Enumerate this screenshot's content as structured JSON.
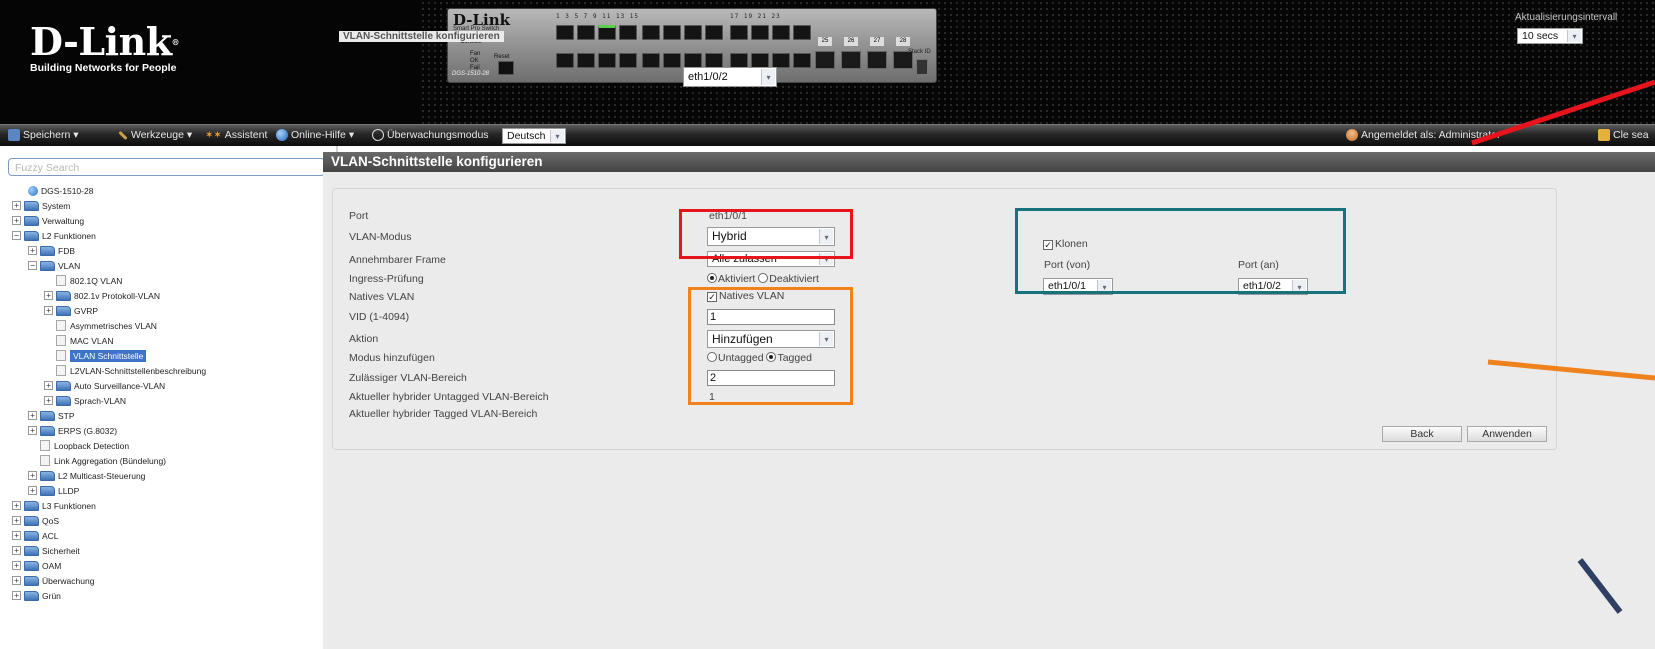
{
  "header": {
    "logo": {
      "name": "D-Link",
      "tagline": "Building Networks for People"
    },
    "switch_panel": {
      "brand": "D-Link",
      "subtitle": "Smart Pro Switch",
      "console_label": "Console",
      "fan_label": "Fan",
      "ok_label": "OK",
      "fail_label": "Fail",
      "reset_label": "Reset",
      "model": "DGS-1510-28",
      "stack_id_label": "Stack ID",
      "sfp_ports": [
        "25",
        "26",
        "27",
        "28"
      ],
      "port_selector": "eth1/0/2"
    },
    "refresh": {
      "label": "Aktualisierungsintervall",
      "value": "10 secs"
    }
  },
  "toolbar": {
    "save": "Speichern",
    "tools": "Werkzeuge",
    "wizard": "Assistent",
    "help": "Online-Hilfe",
    "monitor": "Überwachungsmodus",
    "language": "Deutsch",
    "logged_in": "Angemeldet als: Administrator",
    "clear_session": "Cle sea"
  },
  "sidebar": {
    "search_placeholder": "Fuzzy Search",
    "tree": [
      {
        "label": "DGS-1510-28"
      },
      {
        "label": "System"
      },
      {
        "label": "Verwaltung"
      },
      {
        "label": "L2 Funktionen"
      },
      {
        "label": "FDB"
      },
      {
        "label": "VLAN"
      },
      {
        "label": "802.1Q VLAN"
      },
      {
        "label": "802.1v Protokoll-VLAN"
      },
      {
        "label": "GVRP"
      },
      {
        "label": "Asymmetrisches VLAN"
      },
      {
        "label": "MAC VLAN"
      },
      {
        "label": "VLAN Schnittstelle"
      },
      {
        "label": "L2VLAN-Schnittstellenbeschreibung"
      },
      {
        "label": "Auto Surveillance-VLAN"
      },
      {
        "label": "Sprach-VLAN"
      },
      {
        "label": "STP"
      },
      {
        "label": "ERPS (G.8032)"
      },
      {
        "label": "Loopback Detection"
      },
      {
        "label": "Link Aggregation (Bündelung)"
      },
      {
        "label": "L2 Multicast-Steuerung"
      },
      {
        "label": "LLDP"
      },
      {
        "label": "L3 Funktionen"
      },
      {
        "label": "QoS"
      },
      {
        "label": "ACL"
      },
      {
        "label": "Sicherheit"
      },
      {
        "label": "OAM"
      },
      {
        "label": "Überwachung"
      },
      {
        "label": "Grün"
      }
    ]
  },
  "main": {
    "title": "VLAN-Schnittstelle konfigurieren",
    "legend": "VLAN-Schnittstelle konfigurieren",
    "labels": {
      "port": "Port",
      "vlan_mode": "VLAN-Modus",
      "frame": "Annehmbarer Frame",
      "ingress": "Ingress-Prüfung",
      "native_vlan": "Natives VLAN",
      "vid": "VID (1-4094)",
      "action": "Aktion",
      "add_mode": "Modus hinzufügen",
      "allowed_range": "Zulässiger VLAN-Bereich",
      "untagged_range": "Aktueller hybrider Untagged VLAN-Bereich",
      "tagged_range": "Aktueller hybrider Tagged VLAN-Bereich"
    },
    "values": {
      "port": "eth1/0/1",
      "vlan_mode": "Hybrid",
      "frame": "Alle zulassen",
      "ingress_on": "Aktiviert",
      "ingress_off": "Deaktiviert",
      "native_vlan_check": "Natives VLAN",
      "vid": "1",
      "action": "Hinzufügen",
      "untagged": "Untagged",
      "tagged": "Tagged",
      "allowed_range": "2",
      "untagged_range": "1",
      "tagged_range": ""
    },
    "clone": {
      "label": "Klonen",
      "port_from_label": "Port (von)",
      "port_to_label": "Port (an)",
      "port_from": "eth1/0/1",
      "port_to": "eth1/0/2"
    },
    "buttons": {
      "back": "Back",
      "apply": "Anwenden"
    }
  },
  "annotation_colors": {
    "red": "#e8141c",
    "orange": "#f0821e",
    "teal": "#16737c",
    "navy": "#2e3f63"
  }
}
